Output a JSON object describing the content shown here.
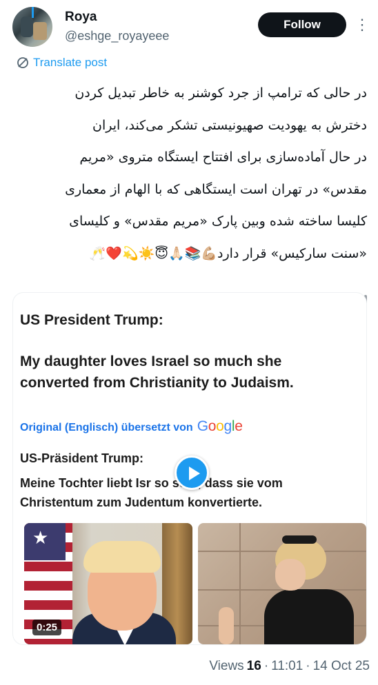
{
  "author": {
    "name": "Roya",
    "handle": "@eshge_royayeee",
    "follow_label": "Follow"
  },
  "translate": {
    "label": "Translate post"
  },
  "post": {
    "lines": [
      "در حالی که ترامپ از جرد کوشنر به خاطر تبدیل کردن",
      "دخترش به یهودیت صهیونیستی تشکر می‌کند، ایران",
      "در حال آماده‌سازی برای افتتاح ایستگاه متروی «مریم",
      "مقدس» در تهران است ایستگاهی که با الهام از معماری",
      "کلیسا ساخته شده وبین پارک «مریم مقدس» و کلیسای",
      "«سنت سارکیس» قرار دارد💪🏼📚🙏🏻😇☀️💫❤️🥂"
    ]
  },
  "media": {
    "title": "US President Trump:",
    "quote": "My daughter loves Israel so much she converted from Christianity to Judaism.",
    "google_prefix": "Original (Englisch) übersetzt von",
    "google_logo": [
      "G",
      "o",
      "o",
      "g",
      "l",
      "e"
    ],
    "de_title": "US-Präsident Trump:",
    "de_quote": "Meine Tochter liebt Isr       so sehr, dass sie vom Christentum zum Judentum konvertierte.",
    "video_time": "0:25"
  },
  "meta": {
    "views_label": "Views",
    "views_count": "16",
    "time": "11:01",
    "date": "14 Oct 25"
  },
  "icons": {
    "translate": "translate-icon",
    "more": "more-icon",
    "play": "play-icon"
  },
  "colors": {
    "accent": "#1d9bf0",
    "follow_bg": "#0f1419",
    "secondary_text": "#536471"
  }
}
